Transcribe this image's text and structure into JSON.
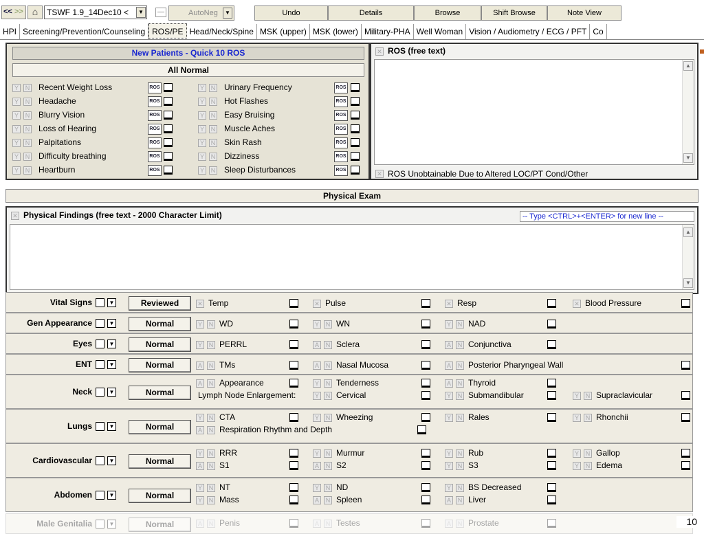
{
  "toolbar": {
    "nav_prev": "<<",
    "nav_next": ">>",
    "template": "TSWF 1.9_14Dec10 <",
    "autoneg": "AutoNeg",
    "undo": "Undo",
    "details": "Details",
    "browse": "Browse",
    "shift_browse": "Shift Browse",
    "note_view": "Note View"
  },
  "tabs": [
    "HPI",
    "Screening/Prevention/Counseling",
    "ROS/PE",
    "Head/Neck/Spine",
    "MSK (upper)",
    "MSK (lower)",
    "Military-PHA",
    "Well Woman",
    "Vision / Audiometry / ECG / PFT",
    "Co"
  ],
  "ros": {
    "title": "New Patients - Quick 10 ROS",
    "all_normal": "All Normal",
    "left_items": [
      "Recent Weight Loss",
      "Headache",
      "Blurry Vision",
      "Loss of Hearing",
      "Palpitations",
      "Difficulty breathing",
      "Heartburn"
    ],
    "right_items": [
      "Urinary Frequency",
      "Hot Flashes",
      "Easy Bruising",
      "Muscle Aches",
      "Skin Rash",
      "Dizziness",
      "Sleep Disturbances"
    ],
    "ros_icon": "ROS",
    "free_text_label": "ROS (free text)",
    "unobtainable": "ROS Unobtainable Due to Altered LOC/PT Cond/Other"
  },
  "exam": {
    "title": "Physical Exam",
    "findings_label": "Physical Findings (free text - 2000 Character Limit)",
    "newline_hint": "-- Type <CTRL>+<ENTER> for new line --",
    "reviewed": "Reviewed",
    "normal": "Normal",
    "rows": {
      "vital": {
        "label": "Vital Signs",
        "items": [
          "Temp",
          "Pulse",
          "Resp",
          "Blood Pressure"
        ]
      },
      "gen": {
        "label": "Gen Appearance",
        "items": [
          "WD",
          "WN",
          "NAD"
        ]
      },
      "eyes": {
        "label": "Eyes",
        "items": [
          "PERRL",
          "Sclera",
          "Conjunctiva"
        ]
      },
      "ent": {
        "label": "ENT",
        "items": [
          "TMs",
          "Nasal Mucosa",
          "Posterior Pharyngeal Wall"
        ]
      },
      "neck": {
        "label": "Neck",
        "items": [
          "Appearance",
          "Tenderness",
          "Thyroid",
          "Cervical",
          "Submandibular",
          "Supraclavicular"
        ],
        "lymph": "Lymph Node Enlargement:"
      },
      "lungs": {
        "label": "Lungs",
        "items": [
          "CTA",
          "Wheezing",
          "Rales",
          "Rhonchii"
        ],
        "resp": "Respiration Rhythm and Depth"
      },
      "cardio": {
        "label": "Cardiovascular",
        "items": [
          "RRR",
          "Murmur",
          "Rub",
          "Gallop",
          "S1",
          "S2",
          "S3",
          "Edema"
        ]
      },
      "abdomen": {
        "label": "Abdomen",
        "items": [
          "NT",
          "ND",
          "BS Decreased",
          "Mass",
          "Spleen",
          "Liver"
        ]
      },
      "male": {
        "label": "Male Genitalia",
        "items": [
          "Penis",
          "Testes",
          "Prostate"
        ]
      }
    }
  },
  "page_number": "10",
  "glyphs": {
    "y": "Y",
    "n": "N",
    "a": "A",
    "x": "✕",
    "home": "⌂",
    "down": "▼",
    "up": "▲"
  }
}
